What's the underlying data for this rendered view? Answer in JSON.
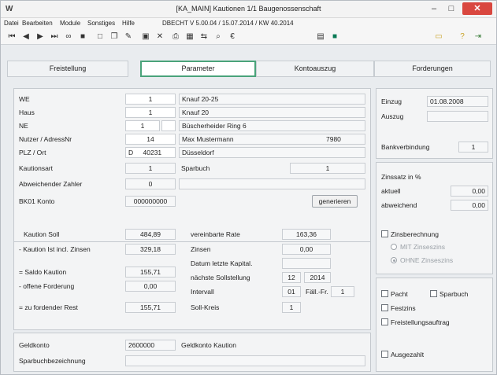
{
  "window": {
    "app_icon": "W",
    "title": "[KA_MAIN] Kautionen 1/1 Baugenossenschaft",
    "min": "–",
    "max": "□",
    "close": "✕"
  },
  "menu": {
    "items": [
      "Datei",
      "Bearbeiten",
      "Module",
      "Sonstiges",
      "Hilfe"
    ],
    "status": "DBECHT V 5.00.04 / 15.07.2014 / KW 40.2014"
  },
  "toolbar": {
    "icons": [
      "first-record-icon",
      "prev-record-icon",
      "next-record-icon",
      "last-record-icon",
      "binoculars-icon",
      "grid-icon",
      "new-doc-icon",
      "copy-doc-icon",
      "edit-doc-icon",
      "save-icon",
      "delete-icon",
      "print-icon",
      "table-icon",
      "merge-icon",
      "search-icon",
      "euro-icon",
      "calculator-icon",
      "record-icon",
      "folder-icon",
      "help-icon",
      "exit-icon"
    ]
  },
  "tabs": [
    "Freistellung",
    "Parameter",
    "Kontoauszug",
    "Forderungen"
  ],
  "form": {
    "we": {
      "label": "WE",
      "value": "1",
      "text": "Knauf 20-25"
    },
    "haus": {
      "label": "Haus",
      "value": "1",
      "text": "Knauf 20"
    },
    "ne": {
      "label": "NE",
      "value": "1",
      "text": "Büscherheider Ring 6"
    },
    "nutzer": {
      "label": "Nutzer / AdressNr",
      "value": "14",
      "text": "Max Mustermann",
      "adressnr": "7980"
    },
    "plz": {
      "label": "PLZ / Ort",
      "land": "D",
      "plz": "40231",
      "ort": "Düsseldorf"
    },
    "kautionsart": {
      "label": "Kautionsart",
      "value": "1",
      "text": "Sparbuch",
      "num": "1"
    },
    "abw_zahler": {
      "label": "Abweichender Zahler",
      "value": "0"
    },
    "bk01": {
      "label": "BK01 Konto",
      "value": "000000000",
      "button": "generieren"
    }
  },
  "amounts": {
    "kaution_soll": {
      "label": "Kaution Soll",
      "value": "484,89"
    },
    "kaution_ist": {
      "label": "- Kaution Ist incl. Zinsen",
      "value": "329,18"
    },
    "saldo": {
      "label": "= Saldo Kaution",
      "value": "155,71"
    },
    "offene": {
      "label": "- offene Forderung",
      "value": "0,00"
    },
    "rest": {
      "label": "= zu fordender Rest",
      "value": "155,71"
    },
    "rate": {
      "label": "vereinbarte Rate",
      "value": "163,36"
    },
    "zinsen": {
      "label": "Zinsen",
      "value": "0,00"
    },
    "datum_kapital": {
      "label": "Datum letzte Kapital."
    },
    "naechste": {
      "label": "nächste Sollstellung",
      "month": "12",
      "year": "2014"
    },
    "intervall": {
      "label": "Intervall",
      "value": "01",
      "faell_label": "Fäll.-Fr.",
      "faell_value": "1"
    },
    "soll_kreis": {
      "label": "Soll-Kreis",
      "value": "1"
    }
  },
  "bottom": {
    "geldkonto": {
      "label": "Geldkonto",
      "value": "2600000",
      "text": "Geldkonto Kaution"
    },
    "sparbuch": {
      "label": "Sparbuchbezeichnung"
    }
  },
  "right": {
    "einzug": {
      "label": "Einzug",
      "value": "01.08.2008"
    },
    "auszug": {
      "label": "Auszug"
    },
    "bankverbindung": {
      "label": "Bankverbindung",
      "value": "1"
    },
    "zinssatz_title": "Zinssatz in %",
    "aktuell": {
      "label": "aktuell",
      "value": "0,00"
    },
    "abweichend": {
      "label": "abweichend",
      "value": "0,00"
    },
    "zinsberechnung": "Zinsberechnung",
    "mit": "MIT Zinseszins",
    "ohne": "OHNE Zinseszins",
    "pacht": "Pacht",
    "sparbuch": "Sparbuch",
    "festzins": "Festzins",
    "freistellung": "Freistellungsauftrag",
    "ausgezahlt": "Ausgezahlt"
  },
  "colors": {
    "active_tab": "#4aa37a",
    "close": "#d9473f"
  }
}
